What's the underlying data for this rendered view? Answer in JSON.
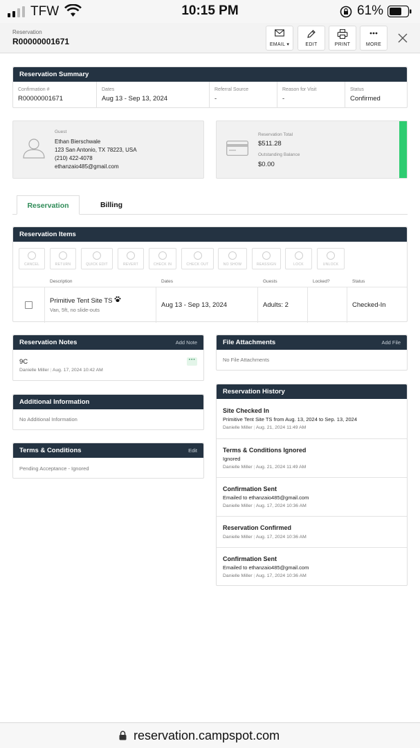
{
  "status_bar": {
    "carrier": "TFW",
    "time": "10:15 PM",
    "battery": "61%"
  },
  "header": {
    "label": "Reservation",
    "reservation_id": "R00000001671",
    "buttons": {
      "email": "EMAIL",
      "edit": "EDIT",
      "print": "PRINT",
      "more": "MORE"
    }
  },
  "summary": {
    "title": "Reservation Summary",
    "fields": [
      {
        "label": "Confirmation #",
        "value": "R00000001671"
      },
      {
        "label": "Dates",
        "value": "Aug 13 - Sep 13, 2024"
      },
      {
        "label": "Referral Source",
        "value": "-"
      },
      {
        "label": "Reason for Visit",
        "value": "-"
      },
      {
        "label": "Status",
        "value": "Confirmed"
      }
    ]
  },
  "guest": {
    "label": "Guest",
    "name": "Ethan Bierschwale",
    "address": "123 San Antonio, TX 78223, USA",
    "phone": "(210) 422-4078",
    "email": "ethanzaio485@gmail.com"
  },
  "totals": {
    "total_label": "Reservation Total",
    "total_value": "$511.28",
    "balance_label": "Outstanding Balance",
    "balance_value": "$0.00"
  },
  "tabs": {
    "reservation": "Reservation",
    "billing": "Billing"
  },
  "items": {
    "title": "Reservation Items",
    "actions": [
      "CANCEL",
      "RETURN",
      "QUICK EDIT",
      "REVERT",
      "CHECK IN",
      "CHECK OUT",
      "NO SHOW",
      "REASSIGN",
      "LOCK",
      "UNLOCK"
    ],
    "columns": {
      "description": "Description",
      "dates": "Dates",
      "guests": "Guests",
      "locked": "Locked?",
      "status": "Status"
    },
    "row": {
      "site": "Primitive Tent Site TS",
      "details": "Van, 5ft, no slide-outs",
      "dates": "Aug 13 - Sep 13, 2024",
      "guests": "Adults: 2",
      "locked": "",
      "status": "Checked-In"
    }
  },
  "notes": {
    "title": "Reservation Notes",
    "action": "Add Note",
    "text": "9C",
    "author": "Danielle Miller",
    "timestamp": "Aug. 17, 2024 10:42 AM"
  },
  "attachments": {
    "title": "File Attachments",
    "action": "Add File",
    "empty": "No File Attachments"
  },
  "additional": {
    "title": "Additional Information",
    "empty": "No Additional Information"
  },
  "terms": {
    "title": "Terms & Conditions",
    "action": "Edit",
    "status": "Pending Acceptance - Ignored"
  },
  "history": {
    "title": "Reservation History",
    "entries": [
      {
        "title": "Site Checked In",
        "desc": "Primitive Tent Site TS from Aug. 13, 2024 to Sep. 13, 2024",
        "author": "Danielle Miller",
        "time": "Aug. 21, 2024 11:49 AM"
      },
      {
        "title": "Terms & Conditions Ignored",
        "desc": "Ignored",
        "author": "Danielle Miller",
        "time": "Aug. 21, 2024 11:49 AM"
      },
      {
        "title": "Confirmation Sent",
        "desc": "Emailed to ethanzaio485@gmail.com",
        "author": "Danielle Miller",
        "time": "Aug. 17, 2024 10:36 AM"
      },
      {
        "title": "Reservation Confirmed",
        "desc": "",
        "author": "Danielle Miller",
        "time": "Aug. 17, 2024 10:36 AM"
      },
      {
        "title": "Confirmation Sent",
        "desc": "Emailed to ethanzaio485@gmail.com",
        "author": "Danielle Miller",
        "time": "Aug. 17, 2024 10:36 AM"
      }
    ]
  },
  "url": "reservation.campspot.com"
}
